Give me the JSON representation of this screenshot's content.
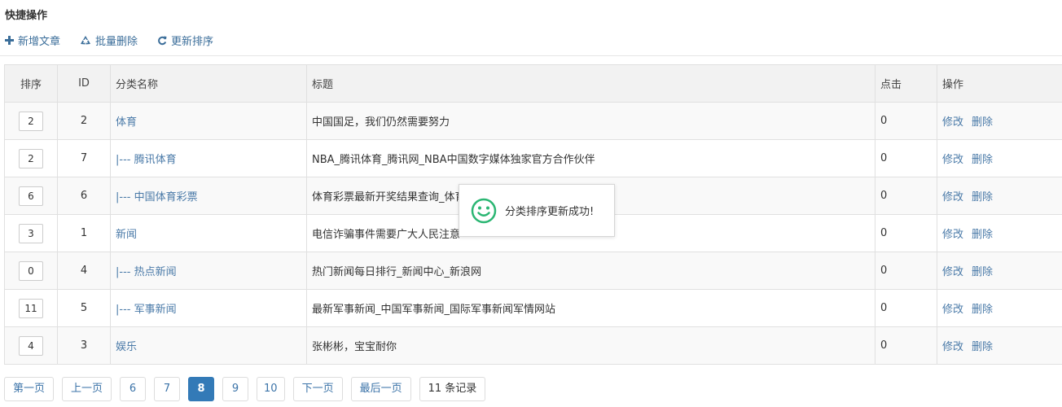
{
  "header": {
    "title": "快捷操作"
  },
  "toolbar": {
    "add_label": "新增文章",
    "batch_delete_label": "批量删除",
    "update_sort_label": "更新排序"
  },
  "table": {
    "columns": [
      "排序",
      "ID",
      "分类名称",
      "标题",
      "点击",
      "操作"
    ],
    "rows": [
      {
        "sort": "2",
        "id": "2",
        "category": "体育",
        "title": "中国国足，我们仍然需要努力",
        "clicks": "0",
        "edit": "修改",
        "delete": "删除"
      },
      {
        "sort": "2",
        "id": "7",
        "category": "|--- 腾讯体育",
        "title": "NBA_腾讯体育_腾讯网_NBA中国数字媒体独家官方合作伙伴",
        "clicks": "0",
        "edit": "修改",
        "delete": "删除"
      },
      {
        "sort": "6",
        "id": "6",
        "category": "|--- 中国体育彩票",
        "title": "体育彩票最新开奖结果查询_体育",
        "clicks": "0",
        "edit": "修改",
        "delete": "删除"
      },
      {
        "sort": "3",
        "id": "1",
        "category": "新闻",
        "title": "电信诈骗事件需要广大人民注意",
        "clicks": "0",
        "edit": "修改",
        "delete": "删除"
      },
      {
        "sort": "0",
        "id": "4",
        "category": "|--- 热点新闻",
        "title": "热门新闻每日排行_新闻中心_新浪网",
        "clicks": "0",
        "edit": "修改",
        "delete": "删除"
      },
      {
        "sort": "11",
        "id": "5",
        "category": "|--- 军事新闻",
        "title": "最新军事新闻_中国军事新闻_国际军事新闻军情网站",
        "clicks": "0",
        "edit": "修改",
        "delete": "删除"
      },
      {
        "sort": "4",
        "id": "3",
        "category": "娱乐",
        "title": "张彬彬，宝宝耐你",
        "clicks": "0",
        "edit": "修改",
        "delete": "删除"
      }
    ]
  },
  "pagination": {
    "first": "第一页",
    "prev": "上一页",
    "pages": [
      "6",
      "7",
      "8",
      "9",
      "10"
    ],
    "current": "8",
    "next": "下一页",
    "last": "最后一页",
    "records": "11 条记录"
  },
  "toast": {
    "message": "分类排序更新成功!",
    "icon": "smile-icon"
  },
  "colors": {
    "link": "#4a7aa8",
    "active_page": "#337ab7",
    "toast_icon": "#2bb673"
  }
}
